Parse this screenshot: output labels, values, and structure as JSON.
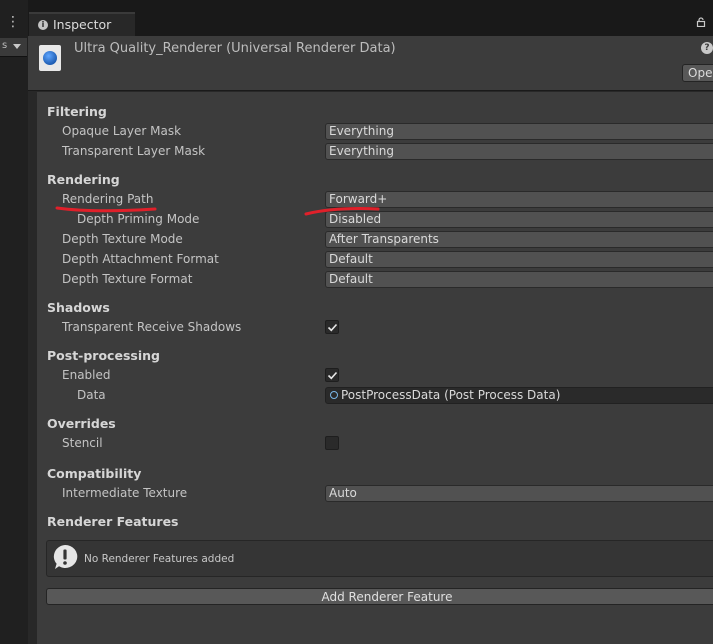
{
  "left_panel": {
    "menu_glyph": "⋮",
    "dropdown_text": "s"
  },
  "tab": {
    "label": "Inspector",
    "info_glyph": "i"
  },
  "header": {
    "title": "Ultra Quality_Renderer (Universal Renderer Data)",
    "help_glyph": "?",
    "open_label": "Ope"
  },
  "sections": {
    "filtering": "Filtering",
    "rendering": "Rendering",
    "shadows": "Shadows",
    "post_processing": "Post-processing",
    "overrides": "Overrides",
    "compatibility": "Compatibility",
    "renderer_features": "Renderer Features"
  },
  "fields": {
    "opaque_layer_mask": {
      "label": "Opaque Layer Mask",
      "value": "Everything"
    },
    "transparent_layer_mask": {
      "label": "Transparent Layer Mask",
      "value": "Everything"
    },
    "rendering_path": {
      "label": "Rendering Path",
      "value": "Forward+"
    },
    "depth_priming_mode": {
      "label": "Depth Priming Mode",
      "value": "Disabled"
    },
    "depth_texture_mode": {
      "label": "Depth Texture Mode",
      "value": "After Transparents"
    },
    "depth_attachment_format": {
      "label": "Depth Attachment Format",
      "value": "Default"
    },
    "depth_texture_format": {
      "label": "Depth Texture Format",
      "value": "Default"
    },
    "transparent_receive_shadows": {
      "label": "Transparent Receive Shadows",
      "checked": true
    },
    "pp_enabled": {
      "label": "Enabled",
      "checked": true
    },
    "pp_data": {
      "label": "Data",
      "value": "PostProcessData (Post Process Data)"
    },
    "stencil": {
      "label": "Stencil",
      "checked": false
    },
    "intermediate_texture": {
      "label": "Intermediate Texture",
      "value": "Auto"
    }
  },
  "features": {
    "empty_message": "No Renderer Features added",
    "add_button": "Add Renderer Feature"
  },
  "colors": {
    "panel": "#3c3c3c",
    "annotation": "#e0202a",
    "accent_icon": "#1e5db3"
  },
  "icons": {
    "lock": "lock-icon",
    "help": "help-icon",
    "warning": "warning-icon",
    "asset": "renderer-asset-icon"
  }
}
